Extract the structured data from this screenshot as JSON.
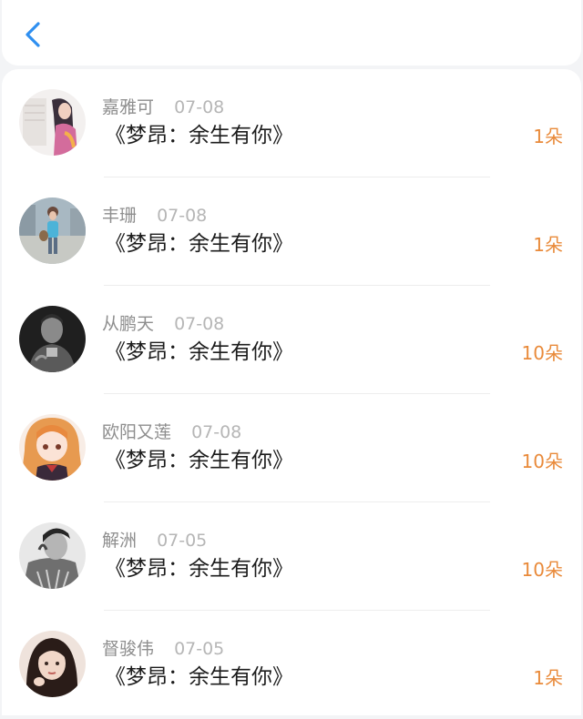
{
  "nav": {
    "back_icon": "chevron-left-icon",
    "accent_color": "#2f8ff0"
  },
  "list": {
    "count_color": "#e98a3a",
    "items": [
      {
        "name": "嘉雅可",
        "date": "07-08",
        "title": "《梦昂：余生有你》",
        "count": "1朵"
      },
      {
        "name": "丰珊",
        "date": "07-08",
        "title": "《梦昂：余生有你》",
        "count": "1朵"
      },
      {
        "name": "从鹏天",
        "date": "07-08",
        "title": "《梦昂：余生有你》",
        "count": "10朵"
      },
      {
        "name": "欧阳又莲",
        "date": "07-08",
        "title": "《梦昂：余生有你》",
        "count": "10朵"
      },
      {
        "name": "解洲",
        "date": "07-05",
        "title": "《梦昂：余生有你》",
        "count": "10朵"
      },
      {
        "name": "督骏伟",
        "date": "07-05",
        "title": "《梦昂：余生有你》",
        "count": "1朵"
      }
    ]
  }
}
